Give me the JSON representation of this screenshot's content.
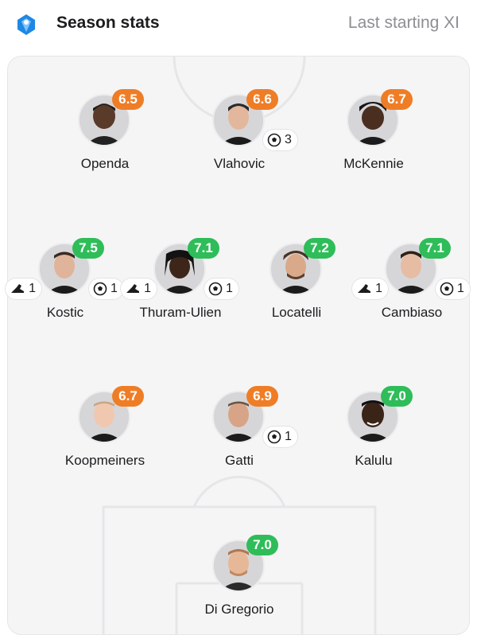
{
  "header": {
    "title": "Season stats",
    "subtitle": "Last starting XI",
    "logo_icon": "league-logo-icon"
  },
  "colors": {
    "rating_orange": "#ef7d26",
    "rating_green": "#2ebd59"
  },
  "players": [
    {
      "name": "Openda",
      "rating": "6.5",
      "rating_color": "orange",
      "goals": null,
      "assists": null
    },
    {
      "name": "Vlahovic",
      "rating": "6.6",
      "rating_color": "orange",
      "goals": "3",
      "assists": null
    },
    {
      "name": "McKennie",
      "rating": "6.7",
      "rating_color": "orange",
      "goals": null,
      "assists": null
    },
    {
      "name": "Kostic",
      "rating": "7.5",
      "rating_color": "green",
      "goals": "1",
      "assists": "1"
    },
    {
      "name": "Thuram-Ulien",
      "rating": "7.1",
      "rating_color": "green",
      "goals": "1",
      "assists": "1"
    },
    {
      "name": "Locatelli",
      "rating": "7.2",
      "rating_color": "green",
      "goals": null,
      "assists": null
    },
    {
      "name": "Cambiaso",
      "rating": "7.1",
      "rating_color": "green",
      "goals": "1",
      "assists": "1"
    },
    {
      "name": "Koopmeiners",
      "rating": "6.7",
      "rating_color": "orange",
      "goals": null,
      "assists": null
    },
    {
      "name": "Gatti",
      "rating": "6.9",
      "rating_color": "orange",
      "goals": "1",
      "assists": null
    },
    {
      "name": "Kalulu",
      "rating": "7.0",
      "rating_color": "green",
      "goals": null,
      "assists": null
    },
    {
      "name": "Di Gregorio",
      "rating": "7.0",
      "rating_color": "green",
      "goals": null,
      "assists": null
    }
  ]
}
